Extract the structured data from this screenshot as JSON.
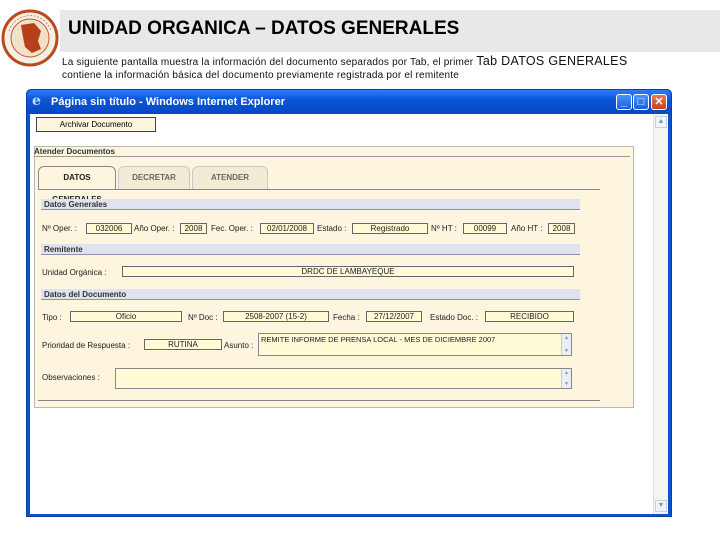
{
  "slide": {
    "title": "UNIDAD ORGANICA – DATOS GENERALES",
    "desc_line1": "La siguiente pantalla muestra la información del documento separados por Tab, el primer",
    "desc_line1_big": "Tab DATOS GENERALES",
    "desc_line2": "contiene la información básica del documento previamente registrada por el remitente"
  },
  "window": {
    "title": "Página sin título - Windows Internet Explorer",
    "icons": {
      "app": "ie-icon",
      "minimize": "minimize-icon",
      "maximize": "maximize-icon",
      "close": "close-icon"
    }
  },
  "app": {
    "archivar_label": "Archivar Documento",
    "panel_title": "Atender Documentos",
    "tabs": [
      {
        "label": "DATOS GENERALES",
        "active": true
      },
      {
        "label": "DECRETAR",
        "active": false
      },
      {
        "label": "ATENDER",
        "active": false
      }
    ],
    "datos_generales": {
      "header": "Datos Generales",
      "nro_oper_label": "Nº Oper. :",
      "nro_oper_value": "032006",
      "anio_oper_label": "Año Oper. :",
      "anio_oper_value": "2008",
      "fec_oper_label": "Fec. Oper. :",
      "fec_oper_value": "02/01/2008",
      "estado_label": "Estado :",
      "estado_value": "Registrado",
      "nro_ht_label": "Nº HT :",
      "nro_ht_value": "00099",
      "anio_ht_label": "Año HT :",
      "anio_ht_value": "2008"
    },
    "remitente": {
      "header": "Remitente",
      "unidad_label": "Unidad Orgánica :",
      "unidad_value": "DRDC DE LAMBAYEQUE"
    },
    "documento": {
      "header": "Datos del Documento",
      "tipo_label": "Tipo :",
      "tipo_value": "Oficio",
      "nro_doc_label": "Nº Doc :",
      "nro_doc_value": "2508-2007 (15-2)",
      "fecha_label": "Fecha :",
      "fecha_value": "27/12/2007",
      "estado_doc_label": "Estado Doc. :",
      "estado_doc_value": "RECIBIDO",
      "prioridad_label": "Prioridad de Respuesta :",
      "prioridad_value": "RUTINA",
      "asunto_label": "Asunto :",
      "asunto_value": "REMITE INFORME DE PRENSA LOCAL - MES DE DICIEMBRE 2007",
      "observaciones_label": "Observaciones :",
      "observaciones_value": ""
    }
  }
}
